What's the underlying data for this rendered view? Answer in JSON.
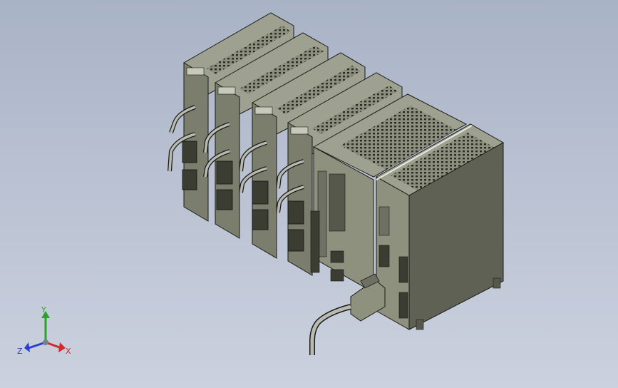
{
  "viewport": {
    "background_top": "#a9b3c6",
    "background_bottom": "#cbd1de"
  },
  "model": {
    "body_color": "#8f917f",
    "body_dark": "#55584a",
    "edge_color": "#1a1b16",
    "cable_color": "#b9bbb2",
    "module_count": 6
  },
  "triad": {
    "y_label": "Y",
    "z_label": "Z",
    "x_label": "X",
    "y_color": "#2fa02f",
    "z_color": "#2a3fd0",
    "x_color": "#d02a2a"
  }
}
